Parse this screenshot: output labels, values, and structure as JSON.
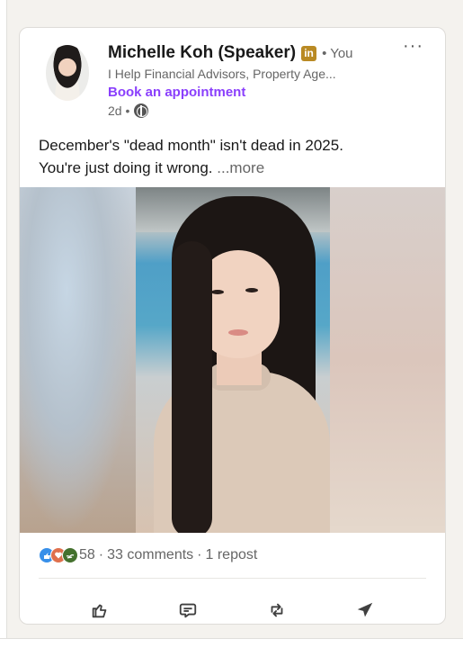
{
  "post": {
    "author_name": "Michelle Koh (Speaker)",
    "linkedin_badge": "in",
    "connection": "• You",
    "headline": "I Help Financial Advisors, Property Age...",
    "cta": "Book an appointment",
    "time": "2d •",
    "more_menu": "···",
    "text_line1": "December's \"dead month\" isn't dead in 2025.",
    "text_line2": "You're just doing it wrong.",
    "see_more": "...more"
  },
  "social": {
    "reaction_count": "58",
    "comments": "33 comments",
    "reposts": "1 repost",
    "separator": "·"
  },
  "icons": {
    "globe": "globe-icon",
    "like": "like-icon",
    "comment": "comment-icon",
    "repost": "repost-icon",
    "send": "send-icon"
  },
  "colors": {
    "cta_purple": "#8a3ffc",
    "badge_gold": "#b98a24",
    "like_blue": "#378fe9",
    "love_red": "#df704d",
    "support_green": "#44712e"
  }
}
